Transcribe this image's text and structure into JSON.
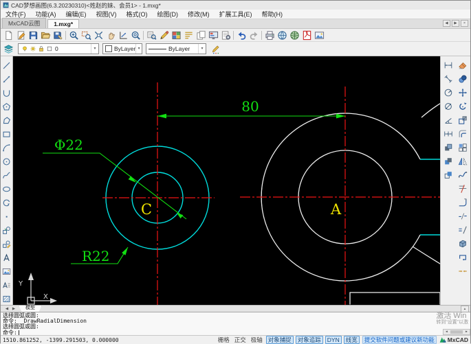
{
  "window": {
    "title": "CAD梦想画图(6.3.20230310)<姓赵的妹、会员1> - 1.mxg*"
  },
  "menu": {
    "items": [
      "文件(F)",
      "功能(A)",
      "编辑(E)",
      "视图(V)",
      "格式(O)",
      "绘图(D)",
      "修改(M)",
      "扩展工具(E)",
      "帮助(H)"
    ]
  },
  "tabs": {
    "items": [
      {
        "label": "MxCAD云图",
        "active": false
      },
      {
        "label": "1.mxg*",
        "active": true
      }
    ]
  },
  "glyphs": {
    "prev": "◀",
    "next": "▶",
    "close": "×",
    "up": "▲",
    "dropdown": "▾"
  },
  "toolbar_main": {
    "items": [
      {
        "icon": "new-file"
      },
      {
        "icon": "open-edit"
      },
      {
        "icon": "save"
      },
      {
        "icon": "open-folder"
      },
      {
        "icon": "save-as"
      },
      {
        "sep": true
      },
      {
        "icon": "zoom-in"
      },
      {
        "icon": "zoom-window"
      },
      {
        "icon": "zoom-extents"
      },
      {
        "icon": "pan-hand"
      },
      {
        "icon": "zoom-scale"
      },
      {
        "icon": "zoom-object"
      },
      {
        "sep": true
      },
      {
        "icon": "find"
      },
      {
        "icon": "pencil-draw"
      },
      {
        "icon": "color-table"
      },
      {
        "icon": "text-style"
      },
      {
        "icon": "copy-doc"
      },
      {
        "icon": "display-settings"
      },
      {
        "icon": "doc-settings"
      },
      {
        "sep": true
      },
      {
        "icon": "undo"
      },
      {
        "icon": "redo"
      },
      {
        "sep": true
      },
      {
        "icon": "print"
      },
      {
        "icon": "publish-web"
      },
      {
        "icon": "publish-web-2"
      },
      {
        "icon": "pdf-export"
      },
      {
        "icon": "image-export"
      }
    ]
  },
  "toolbar_properties": {
    "left_icons": [
      {
        "icon": "layers-stack"
      }
    ],
    "layer_status_icons": [
      {
        "icon": "bulb"
      },
      {
        "icon": "sun"
      },
      {
        "icon": "lock"
      },
      {
        "icon": "swatch"
      }
    ],
    "layer_name": "0",
    "color_value": "ByLayer",
    "linetype_value": "ByLayer",
    "right_icons": [
      {
        "icon": "draw-settings"
      }
    ]
  },
  "left_toolbar": {
    "items": [
      {
        "icon": "draw-line"
      },
      {
        "icon": "draw-xline"
      },
      {
        "icon": "draw-arc-u"
      },
      {
        "icon": "draw-polygon"
      },
      {
        "icon": "draw-polyline"
      },
      {
        "icon": "draw-rect"
      },
      {
        "icon": "draw-arc"
      },
      {
        "icon": "draw-circle"
      },
      {
        "icon": "draw-spline"
      },
      {
        "icon": "draw-ellipse"
      },
      {
        "icon": "draw-revcloud"
      },
      {
        "icon": "draw-point"
      },
      {
        "icon": "block-insert"
      },
      {
        "icon": "block-create"
      },
      {
        "icon": "draw-text"
      },
      {
        "icon": "insert-image"
      },
      {
        "icon": "draw-mtext"
      },
      {
        "icon": "draw-hatch"
      }
    ]
  },
  "right_toolbar": {
    "col1": [
      {
        "icon": "dim-linear"
      },
      {
        "icon": "dim-aligned"
      },
      {
        "icon": "dim-radius"
      },
      {
        "icon": "dim-diameter"
      },
      {
        "icon": "dim-angular"
      },
      {
        "icon": "dim-continue"
      },
      {
        "icon": "dim-quick"
      },
      {
        "icon": "dim-baseline"
      },
      {
        "icon": "dim-edit"
      }
    ],
    "col2": [
      {
        "icon": "erase"
      },
      {
        "icon": "copy"
      },
      {
        "icon": "move"
      },
      {
        "icon": "rotate"
      },
      {
        "icon": "scale"
      },
      {
        "icon": "offset"
      },
      {
        "icon": "array"
      },
      {
        "icon": "mirror"
      },
      {
        "icon": "edit-spline"
      },
      {
        "icon": "trim"
      },
      {
        "icon": "extend"
      },
      {
        "icon": "break"
      },
      {
        "icon": "chamfer"
      },
      {
        "icon": "box-3d"
      },
      {
        "icon": "edit-pline"
      },
      {
        "icon": "join"
      }
    ]
  },
  "canvas": {
    "labels": {
      "dim_80": "80",
      "diameter": "Φ22",
      "radius": "R22",
      "circle_c": "C",
      "circle_a": "A"
    },
    "ucs": {
      "x_label": "X",
      "y_label": "Y"
    },
    "colors": {
      "cyan": "#00dcdc",
      "white": "#ededed",
      "red": "#f01414",
      "green": "#12df12",
      "yellow": "#f0e400"
    }
  },
  "model_tabs": {
    "items": [
      "模型"
    ]
  },
  "command": {
    "lines": [
      "选择圆弧或圆:",
      "命令: _DrawRadialDimension",
      "选择圆弧或圆:"
    ],
    "prompt": "命令:"
  },
  "status_bar": {
    "coordinates": "1510.861252, -1399.291503, 0.000000",
    "toggles": [
      {
        "label": "栅格",
        "pressed": false
      },
      {
        "label": "正交",
        "pressed": false
      },
      {
        "label": "极轴",
        "pressed": false
      },
      {
        "label": "对象捕捉",
        "pressed": true
      },
      {
        "label": "对象追踪",
        "pressed": true
      },
      {
        "label": "DYN",
        "pressed": true
      },
      {
        "label": "线宽",
        "pressed": true
      }
    ],
    "link": "提交软件问题或建议新功能",
    "brand": "MxCAD"
  },
  "watermark": {
    "line1": "激活 Win",
    "line2": "转到“设置”以激"
  }
}
